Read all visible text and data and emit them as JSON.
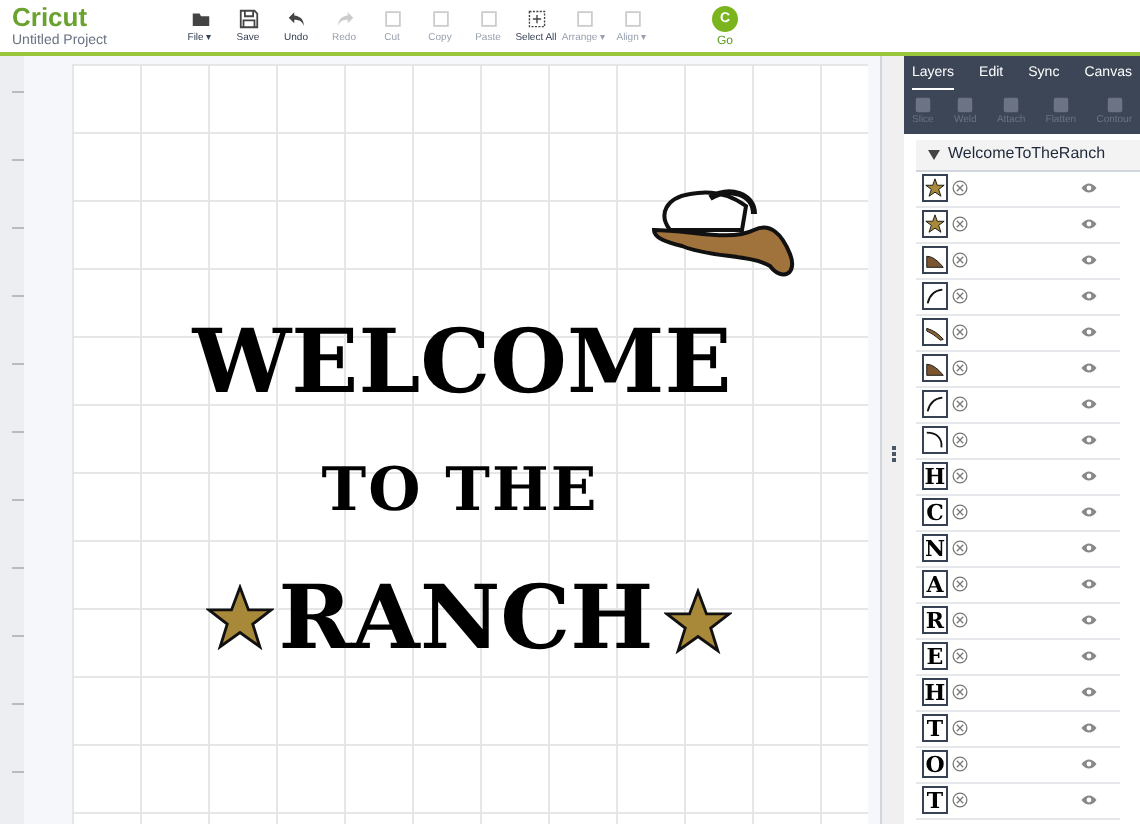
{
  "app": {
    "logo": "Cricut",
    "project": "Untitled Project"
  },
  "toolbar": [
    {
      "label": "File ▾",
      "kind": "folder",
      "disabled": false
    },
    {
      "label": "Save",
      "kind": "save",
      "disabled": false
    },
    {
      "label": "Undo",
      "kind": "undo",
      "disabled": false
    },
    {
      "label": "Redo",
      "kind": "redo",
      "disabled": true
    },
    {
      "label": "Cut",
      "kind": "box",
      "disabled": true
    },
    {
      "label": "Copy",
      "kind": "box",
      "disabled": true
    },
    {
      "label": "Paste",
      "kind": "box",
      "disabled": true
    },
    {
      "label": "Select All",
      "kind": "select",
      "disabled": false
    },
    {
      "label": "Arrange ▾",
      "kind": "box",
      "disabled": true
    },
    {
      "label": "Align ▾",
      "kind": "box",
      "disabled": true
    }
  ],
  "go_button": {
    "label": "Go",
    "badge": "C"
  },
  "design": {
    "line_1": "WELCOME",
    "line_2": "TO THE",
    "line_3": "RANCH"
  },
  "panel": {
    "tabs": [
      {
        "label": "Layers",
        "selected": true
      },
      {
        "label": "Edit",
        "selected": false
      },
      {
        "label": "Sync",
        "selected": false
      },
      {
        "label": "Canvas",
        "selected": false
      }
    ],
    "actions": [
      {
        "label": "Slice",
        "disabled": true
      },
      {
        "label": "Weld",
        "disabled": true
      },
      {
        "label": "Attach",
        "disabled": true
      },
      {
        "label": "Flatten",
        "disabled": true
      },
      {
        "label": "Contour",
        "disabled": true
      }
    ],
    "group": {
      "name": "WelcomeToTheRanch",
      "expanded": true
    },
    "layers": [
      {
        "kind": "star"
      },
      {
        "kind": "star"
      },
      {
        "kind": "hat"
      },
      {
        "kind": "curve"
      },
      {
        "kind": "band"
      },
      {
        "kind": "hat"
      },
      {
        "kind": "curve"
      },
      {
        "kind": "hook"
      },
      {
        "kind": "letter",
        "glyph": "H"
      },
      {
        "kind": "letter",
        "glyph": "C"
      },
      {
        "kind": "letter",
        "glyph": "N"
      },
      {
        "kind": "letter",
        "glyph": "A"
      },
      {
        "kind": "letter",
        "glyph": "R"
      },
      {
        "kind": "letter",
        "glyph": "E"
      },
      {
        "kind": "letter",
        "glyph": "H"
      },
      {
        "kind": "letter",
        "glyph": "T"
      },
      {
        "kind": "letter",
        "glyph": "O"
      },
      {
        "kind": "letter",
        "glyph": "T"
      }
    ]
  }
}
